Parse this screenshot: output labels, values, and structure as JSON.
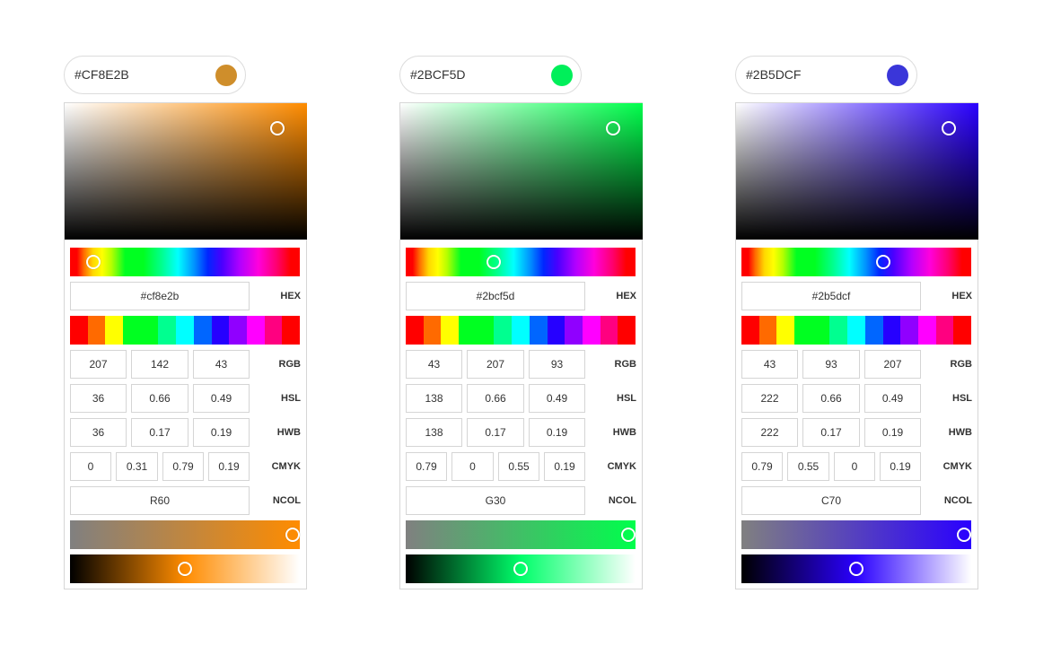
{
  "labels": {
    "hex": "HEX",
    "rgb": "RGB",
    "hsl": "HSL",
    "hwb": "HWB",
    "cmyk": "CMYK",
    "ncol": "NCOL"
  },
  "palette_strip": [
    "#ff0000",
    "#ff6a00",
    "#ffff00",
    "#00ff21",
    "#00ff21",
    "#00ff90",
    "#00ffff",
    "#0066ff",
    "#2600ff",
    "#9000ff",
    "#ff00ff",
    "#ff0080",
    "#ff0000"
  ],
  "pickers": [
    {
      "id": "orange",
      "pill_text": "#CF8E2B",
      "color": "#cf8e2b",
      "pure_hue": "#ff8c00",
      "hex_value": "#cf8e2b",
      "rgb": [
        "207",
        "142",
        "43"
      ],
      "hsl": [
        "36",
        "0.66",
        "0.49"
      ],
      "hwb": [
        "36",
        "0.17",
        "0.19"
      ],
      "cmyk": [
        "0",
        "0.31",
        "0.79",
        "0.19"
      ],
      "ncol": "R60",
      "sat_from": "#808080",
      "sat_to": "#ff8c00",
      "light_from": "#000000",
      "light_mid": "#ff8c00",
      "light_to": "#ffffff"
    },
    {
      "id": "green",
      "pill_text": "#2BCF5D",
      "color": "#2bcf5d",
      "pure_hue": "#00ff4c",
      "hex_value": "#2bcf5d",
      "rgb": [
        "43",
        "207",
        "93"
      ],
      "hsl": [
        "138",
        "0.66",
        "0.49"
      ],
      "hwb": [
        "138",
        "0.17",
        "0.19"
      ],
      "cmyk": [
        "0.79",
        "0",
        "0.55",
        "0.19"
      ],
      "ncol": "G30",
      "sat_from": "#808080",
      "sat_to": "#00ff4c",
      "light_from": "#000000",
      "light_mid": "#00ff6a",
      "light_to": "#ffffff"
    },
    {
      "id": "blue",
      "pill_text": "#2B5DCF",
      "color": "#2b5dcf",
      "pure_hue": "#2a00ff",
      "hex_value": "#2b5dcf",
      "rgb": [
        "43",
        "93",
        "207"
      ],
      "hsl": [
        "222",
        "0.66",
        "0.49"
      ],
      "hwb": [
        "222",
        "0.17",
        "0.19"
      ],
      "cmyk": [
        "0.79",
        "0.55",
        "0",
        "0.19"
      ],
      "ncol": "C70",
      "sat_from": "#808080",
      "sat_to": "#2a00ff",
      "light_from": "#000000",
      "light_mid": "#2a00ff",
      "light_to": "#ffffff"
    }
  ]
}
